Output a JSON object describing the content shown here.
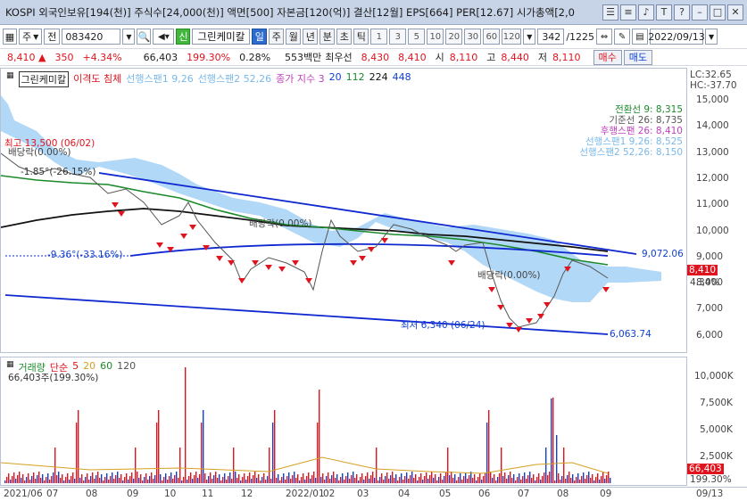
{
  "window": {
    "title": "KOSPI 외국인보유[194(천)] 주식수[24,000(천)] 액면[500] 자본금[120(억)] 결산[12월] EPS[664] PER[12.67] 시가총액[2,0"
  },
  "toolbar": {
    "market": "주",
    "type": "전",
    "code": "083420",
    "name_badge": "신",
    "name": "그린케미칼",
    "periods": [
      "일",
      "주",
      "월",
      "년",
      "분",
      "초",
      "틱"
    ],
    "active_period": "일",
    "intervals": [
      "1",
      "3",
      "5",
      "10",
      "20",
      "30",
      "60",
      "120"
    ],
    "count": "342",
    "total": "/1225",
    "date": "2022/09/13"
  },
  "quote": {
    "price": "8,410",
    "change": "350",
    "change_pct": "+4.34%",
    "volume": "66,403",
    "volume_ratio": "199.30%",
    "turnover": "0.28%",
    "amount": "553백만",
    "pref_label": "최우선",
    "best_ask": "8,430",
    "best_bid": "8,410",
    "open_label": "시",
    "open": "8,110",
    "high_label": "고",
    "high": "8,440",
    "low_label": "저",
    "low": "8,110",
    "buy_label": "매수",
    "sell_label": "매도"
  },
  "main_legend": {
    "name": "그린케미칼",
    "disparity": "이격도 침체",
    "span1": "선행스팬1 9,26",
    "span2": "선행스팬2 52,26",
    "close_index": "종가 지수 3",
    "ma": [
      "20",
      "112",
      "224",
      "448"
    ]
  },
  "ichimoku_legend": [
    {
      "text": "전환선 9: 8,315",
      "color": "#1a8a2a"
    },
    {
      "text": "기준선 26: 8,735",
      "color": "#555555"
    },
    {
      "text": "후행스팬 26: 8,410",
      "color": "#c040c0"
    },
    {
      "text": "선행스팬1 9,26: 8,525",
      "color": "#7ab8e8"
    },
    {
      "text": "선행스팬2 52,26: 8,150",
      "color": "#7ab8e8"
    }
  ],
  "annotations": {
    "high": "최고 13,500 (06/02)",
    "dividend1": "배당락(0.00%)",
    "angle1": "-1.85°(-26.15%)",
    "dividend2": "배당락(0.00%)",
    "angle2": "-9.36°(-33.16%)",
    "dividend3": "배당락(0.00%)",
    "low": "최저 6,340 (06/24)",
    "upper_line_value": "9,072.06",
    "lower_line_value": "6,063.74",
    "lc": "LC:32.65",
    "hc": "HC:-37.70"
  },
  "price_axis": {
    "labels": [
      "15,000",
      "14,000",
      "13,000",
      "12,000",
      "11,000",
      "10,000",
      "9,000",
      "8,000",
      "7,000",
      "6,000"
    ],
    "current": "8,410",
    "current_pct": "4.34%"
  },
  "volume_legend": {
    "label": "거래량",
    "ma_label": "단순",
    "ma": [
      "5",
      "20",
      "60",
      "120"
    ],
    "value": "66,403주(199.30%)"
  },
  "volume_axis": {
    "labels": [
      "10,000K",
      "7,500K",
      "5,000K",
      "2,500K"
    ],
    "current": "66,403",
    "current_pct": "199.30%"
  },
  "date_axis": {
    "labels": [
      "2021/06",
      "07",
      "08",
      "09",
      "10",
      "11",
      "12",
      "2022/01",
      "02",
      "03",
      "04",
      "05",
      "06",
      "07",
      "08",
      "09"
    ],
    "cursor": "09/13"
  },
  "colors": {
    "up": "#e0141e",
    "down": "#1040d0",
    "cloud": "#a8d4f5",
    "ma_green": "#1a8a2a",
    "ma_black": "#111111",
    "trendline": "#1028d0"
  }
}
